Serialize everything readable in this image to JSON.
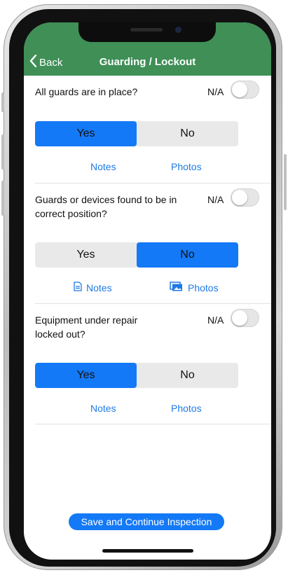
{
  "nav": {
    "back_label": "Back",
    "title": "Guarding / Lockout"
  },
  "questions": [
    {
      "text": "All guards are in place?",
      "na_label": "N/A",
      "na_enabled": false,
      "options": [
        "Yes",
        "No"
      ],
      "selected": "Yes",
      "notes_label": "Notes",
      "photos_label": "Photos",
      "notes_icon": null,
      "photos_icon": null
    },
    {
      "text": "Guards or devices found to be in correct position?",
      "na_label": "N/A",
      "na_enabled": false,
      "options": [
        "Yes",
        "No"
      ],
      "selected": "No",
      "notes_label": "Notes",
      "photos_label": "Photos",
      "notes_icon": "document-icon",
      "photos_icon": "photos-icon"
    },
    {
      "text": "Equipment under repair locked out?",
      "na_label": "N/A",
      "na_enabled": false,
      "options": [
        "Yes",
        "No"
      ],
      "selected": "Yes",
      "notes_label": "Notes",
      "photos_label": "Photos",
      "notes_icon": null,
      "photos_icon": null
    }
  ],
  "footer": {
    "save_label": "Save and Continue Inspection"
  },
  "colors": {
    "nav_green": "#3f8f57",
    "accent_blue": "#1479f6",
    "link_blue": "#1e7ae6",
    "segment_bg": "#e9e9ea"
  }
}
